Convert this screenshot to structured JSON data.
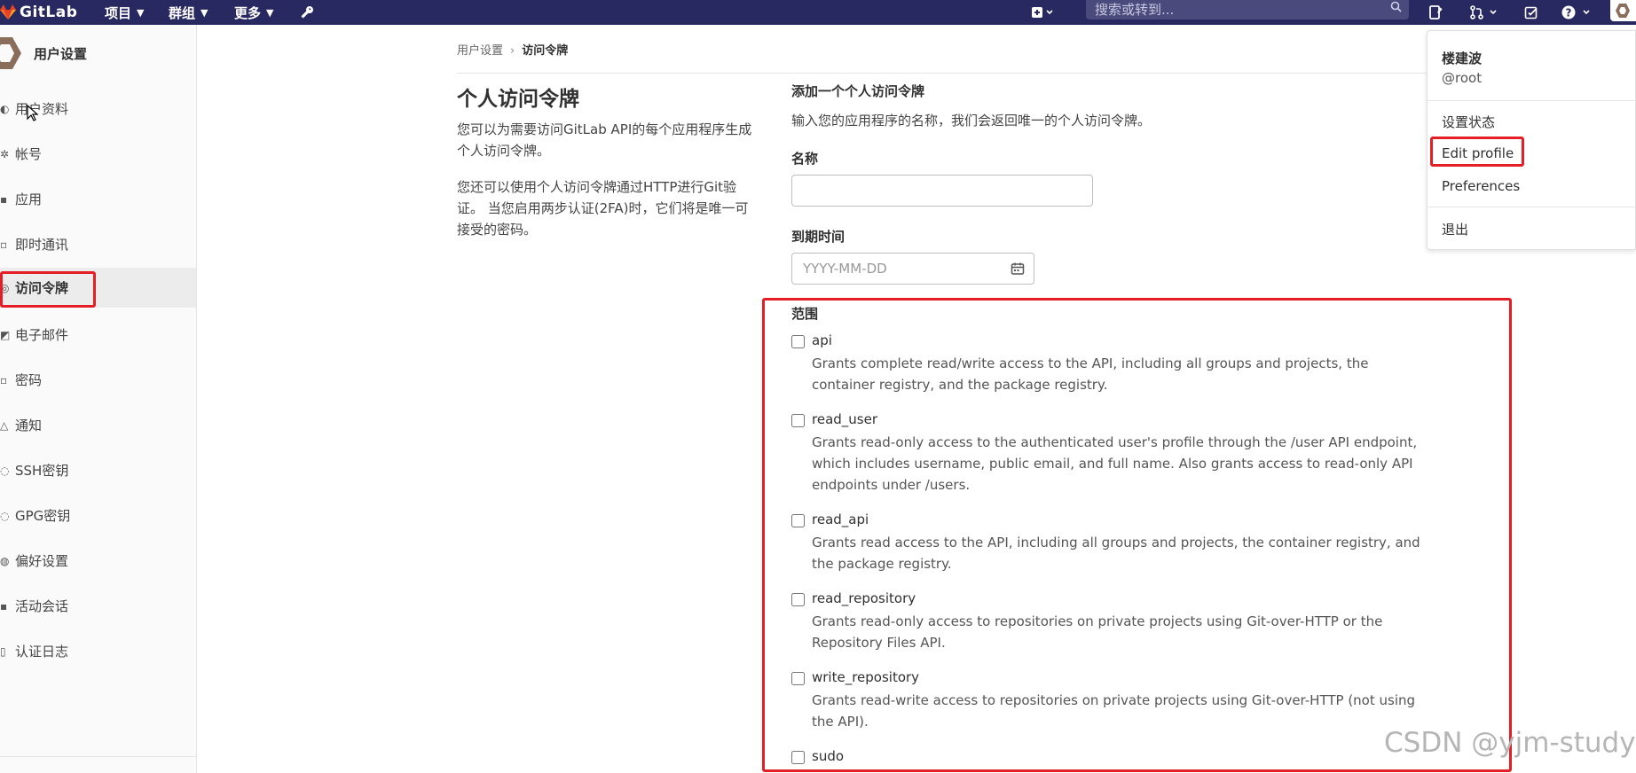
{
  "navbar": {
    "brand": "GitLab",
    "projects": "项目",
    "groups": "群组",
    "more": "更多",
    "search_placeholder": "搜索或转到..."
  },
  "sidebar": {
    "title": "用户设置",
    "items": [
      {
        "label": "用户资料",
        "icon": "user-icon"
      },
      {
        "label": "帐号",
        "icon": "gear-icon"
      },
      {
        "label": "应用",
        "icon": "apps-icon"
      },
      {
        "label": "即时通讯",
        "icon": "chat-icon"
      },
      {
        "label": "访问令牌",
        "icon": "token-icon",
        "active": true
      },
      {
        "label": "电子邮件",
        "icon": "email-icon"
      },
      {
        "label": "密码",
        "icon": "lock-icon"
      },
      {
        "label": "通知",
        "icon": "bell-icon"
      },
      {
        "label": "SSH密钥",
        "icon": "key-icon"
      },
      {
        "label": "GPG密钥",
        "icon": "key-icon"
      },
      {
        "label": "偏好设置",
        "icon": "preferences-icon"
      },
      {
        "label": "活动会话",
        "icon": "session-icon"
      },
      {
        "label": "认证日志",
        "icon": "log-icon"
      }
    ]
  },
  "breadcrumb": {
    "parent": "用户设置",
    "current": "访问令牌"
  },
  "page": {
    "title": "个人访问令牌",
    "desc1": "您可以为需要访问GitLab API的每个应用程序生成个人访问令牌。",
    "desc2": "您还可以使用个人访问令牌通过HTTP进行Git验证。 当您启用两步认证(2FA)时，它们将是唯一可接受的密码。"
  },
  "form": {
    "title": "添加一个个人访问令牌",
    "desc": "输入您的应用程序的名称，我们会返回唯一的个人访问令牌。",
    "name_label": "名称",
    "name_value": "",
    "expires_label": "到期时间",
    "expires_placeholder": "YYYY-MM-DD",
    "scopes_label": "范围",
    "scopes": [
      {
        "name": "api",
        "desc": "Grants complete read/write access to the API, including all groups and projects, the container registry, and the package registry."
      },
      {
        "name": "read_user",
        "desc": "Grants read-only access to the authenticated user's profile through the /user API endpoint, which includes username, public email, and full name. Also grants access to read-only API endpoints under /users."
      },
      {
        "name": "read_api",
        "desc": "Grants read access to the API, including all groups and projects, the container registry, and the package registry."
      },
      {
        "name": "read_repository",
        "desc": "Grants read-only access to repositories on private projects using Git-over-HTTP or the Repository Files API."
      },
      {
        "name": "write_repository",
        "desc": "Grants read-write access to repositories on private projects using Git-over-HTTP (not using the API)."
      },
      {
        "name": "sudo",
        "desc": ""
      }
    ]
  },
  "user_menu": {
    "name": "楼建波",
    "username": "@root",
    "set_status": "设置状态",
    "edit_profile": "Edit profile",
    "preferences": "Preferences",
    "sign_out": "退出"
  },
  "watermark": "CSDN @yjm-study",
  "colors": {
    "navbar": "#292961",
    "highlight": "#e41e26"
  }
}
